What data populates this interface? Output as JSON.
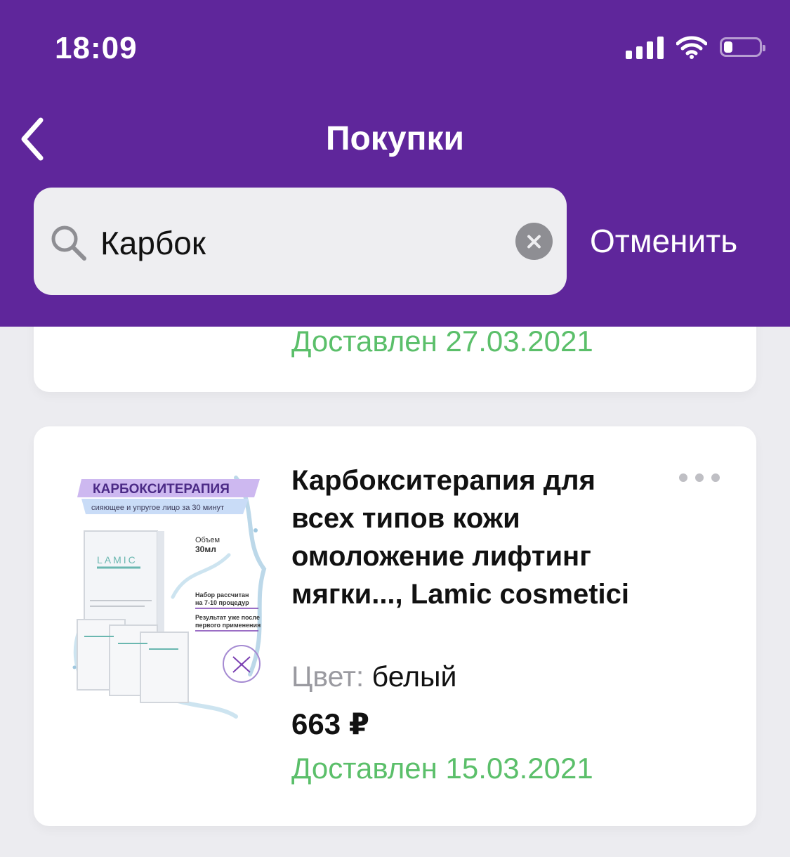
{
  "status_bar": {
    "time": "18:09",
    "battery_level": 0.25
  },
  "nav": {
    "title": "Покупки"
  },
  "search": {
    "value": "Карбок",
    "cancel_label": "Отменить"
  },
  "previous_order": {
    "status": "Доставлен 27.03.2021"
  },
  "order": {
    "title": "Карбокситерапия для всех типов кожи омоложение лифтинг мягки..., Lamic cosmetici",
    "color_label": "Цвет:",
    "color_value": "белый",
    "price": "663 ₽",
    "status": "Доставлен 15.03.2021",
    "image": {
      "banner": "КАРБОКСИТЕРАПИЯ",
      "subtitle": "сияющее и упругое лицо за 30 минут",
      "volume_label": "Объем",
      "volume_value": "30мл",
      "note1_line1": "Набор рассчитан",
      "note1_line2": "на 7-10 процедур",
      "note2_line1": "Результат уже после",
      "note2_line2": "первого применения",
      "brand": "LAMIC"
    }
  },
  "colors": {
    "header": "#5f269b",
    "status_green": "#5bbf6a",
    "background": "#ececf0"
  }
}
